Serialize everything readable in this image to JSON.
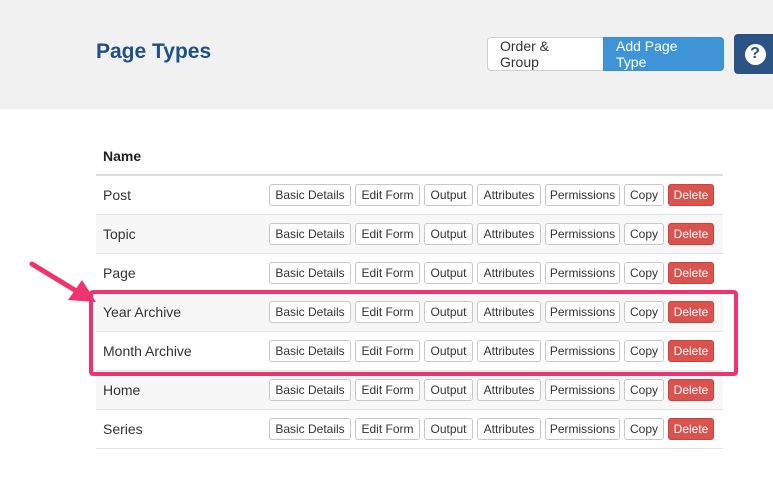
{
  "header": {
    "title": "Page Types",
    "order_group_label": "Order & Group",
    "add_page_type_label": "Add Page Type",
    "help_icon": "question-circle-icon",
    "help_glyph": "?"
  },
  "table": {
    "column_name": "Name",
    "action_labels": {
      "basic_details": "Basic Details",
      "edit_form": "Edit Form",
      "output": "Output",
      "attributes": "Attributes",
      "permissions": "Permissions",
      "copy": "Copy",
      "delete": "Delete"
    },
    "rows": [
      {
        "name": "Post"
      },
      {
        "name": "Topic"
      },
      {
        "name": "Page"
      },
      {
        "name": "Year Archive"
      },
      {
        "name": "Month Archive"
      },
      {
        "name": "Home"
      },
      {
        "name": "Series"
      }
    ]
  },
  "annotation": {
    "highlight_color": "#f0326f",
    "highlighted_rows": [
      "Year Archive",
      "Month Archive"
    ]
  },
  "colors": {
    "title": "#1f4f87",
    "primary_button": "#3e94d6",
    "help_button": "#2b5485",
    "delete_button": "#d9534f"
  }
}
